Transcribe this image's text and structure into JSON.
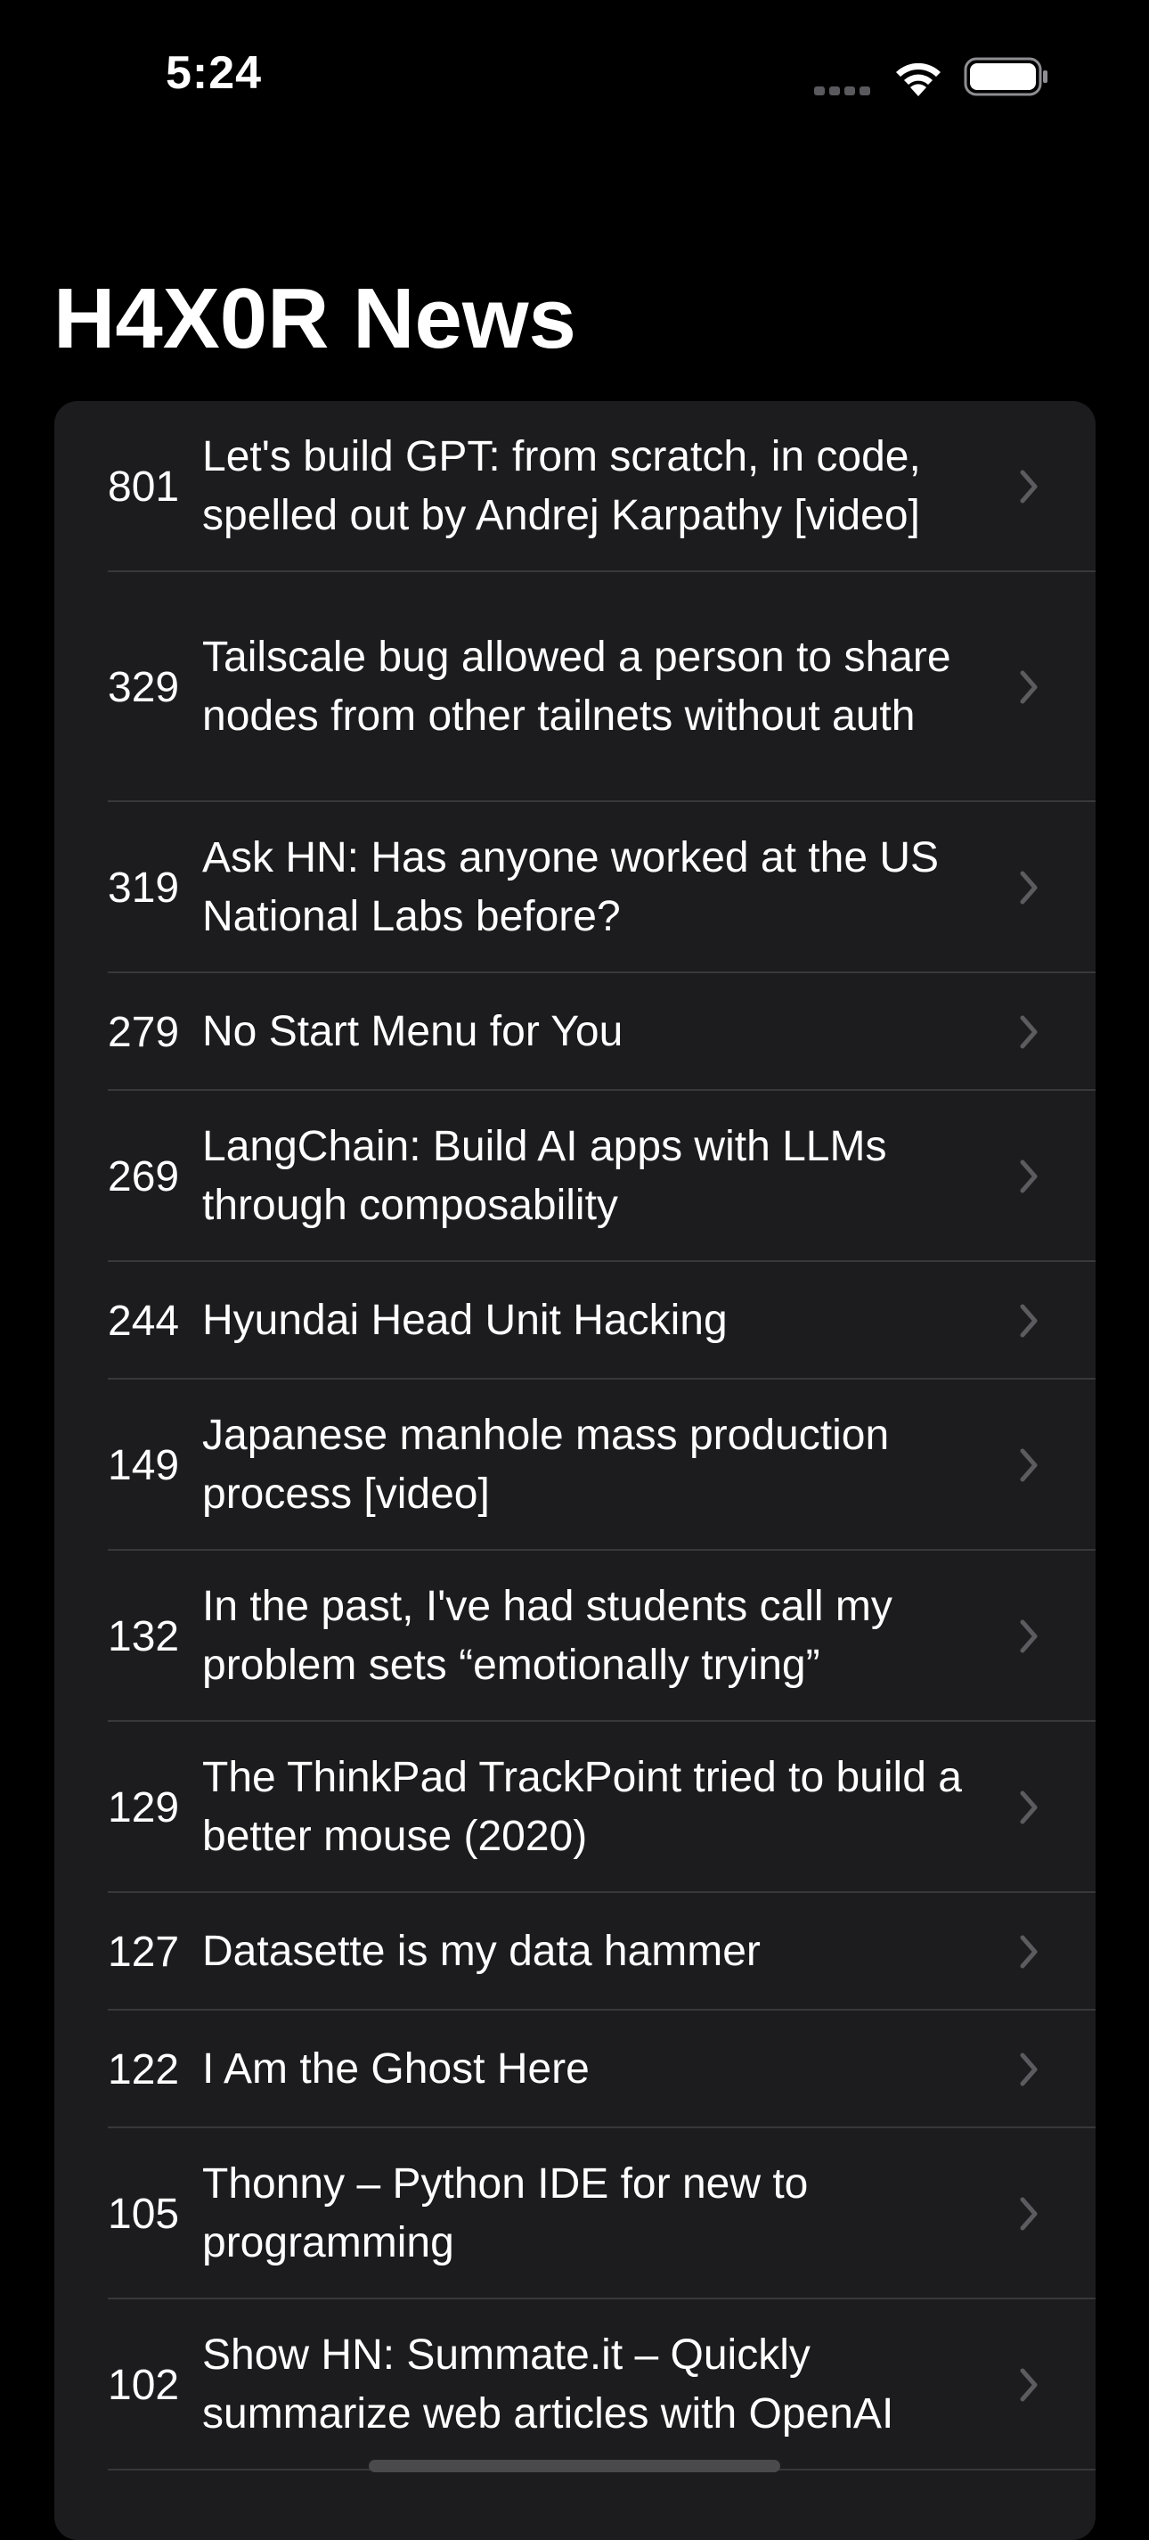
{
  "status_bar": {
    "time": "5:24"
  },
  "header": {
    "title": "H4X0R News"
  },
  "stories": [
    {
      "score": "801",
      "title": "Let's build GPT: from scratch, in code, spelled out by Andrej Karpathy [video]",
      "lines": 2
    },
    {
      "score": "329",
      "title": "Tailscale bug allowed a person to share nodes from other tailnets without auth",
      "lines": 3
    },
    {
      "score": "319",
      "title": "Ask HN: Has anyone worked at the US National Labs before?",
      "lines": 2
    },
    {
      "score": "279",
      "title": "No Start Menu for You",
      "lines": 1
    },
    {
      "score": "269",
      "title": "LangChain: Build AI apps with LLMs through composability",
      "lines": 2
    },
    {
      "score": "244",
      "title": "Hyundai Head Unit Hacking",
      "lines": 1
    },
    {
      "score": "149",
      "title": "Japanese manhole mass production process [video]",
      "lines": 2
    },
    {
      "score": "132",
      "title": "In the past, I've had students call my problem sets “emotionally trying”",
      "lines": 2
    },
    {
      "score": "129",
      "title": "The ThinkPad TrackPoint tried to build a better mouse (2020)",
      "lines": 2
    },
    {
      "score": "127",
      "title": "Datasette is my data hammer",
      "lines": 1
    },
    {
      "score": "122",
      "title": "I Am the Ghost Here",
      "lines": 1
    },
    {
      "score": "105",
      "title": "Thonny – Python IDE for new to programming",
      "lines": 2
    },
    {
      "score": "102",
      "title": "Show HN: Summate.it – Quickly summarize web articles with OpenAI",
      "lines": 2
    }
  ],
  "colors": {
    "background": "#000000",
    "card": "#1c1c1e",
    "separator": "#38383a",
    "chevron": "#5b5b60",
    "text": "#ffffff"
  },
  "icons": {
    "row_disclosure": "chevron-right-icon",
    "wifi": "wifi-icon",
    "battery": "battery-icon",
    "cellular": "cellular-signal-icon"
  }
}
